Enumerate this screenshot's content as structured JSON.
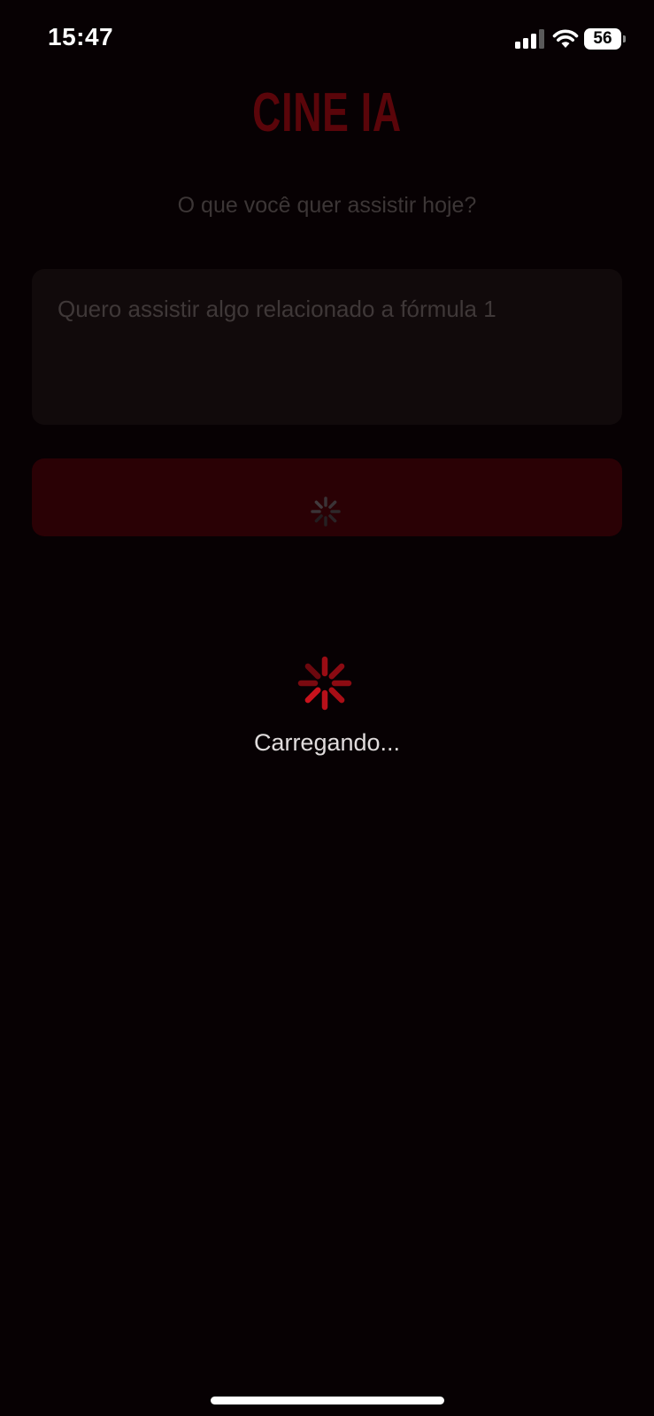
{
  "status_bar": {
    "time": "15:47",
    "battery_level": "56"
  },
  "app": {
    "title": "CINE IA",
    "subtitle": "O que você quer assistir hoje?",
    "prompt_value": "Quero assistir algo relacionado a fórmula 1"
  },
  "loading": {
    "text": "Carregando..."
  },
  "colors": {
    "background": "#070103",
    "accent": "#c0101a",
    "title_dimmed": "#5a050a",
    "button_dimmed": "#2a0105"
  }
}
